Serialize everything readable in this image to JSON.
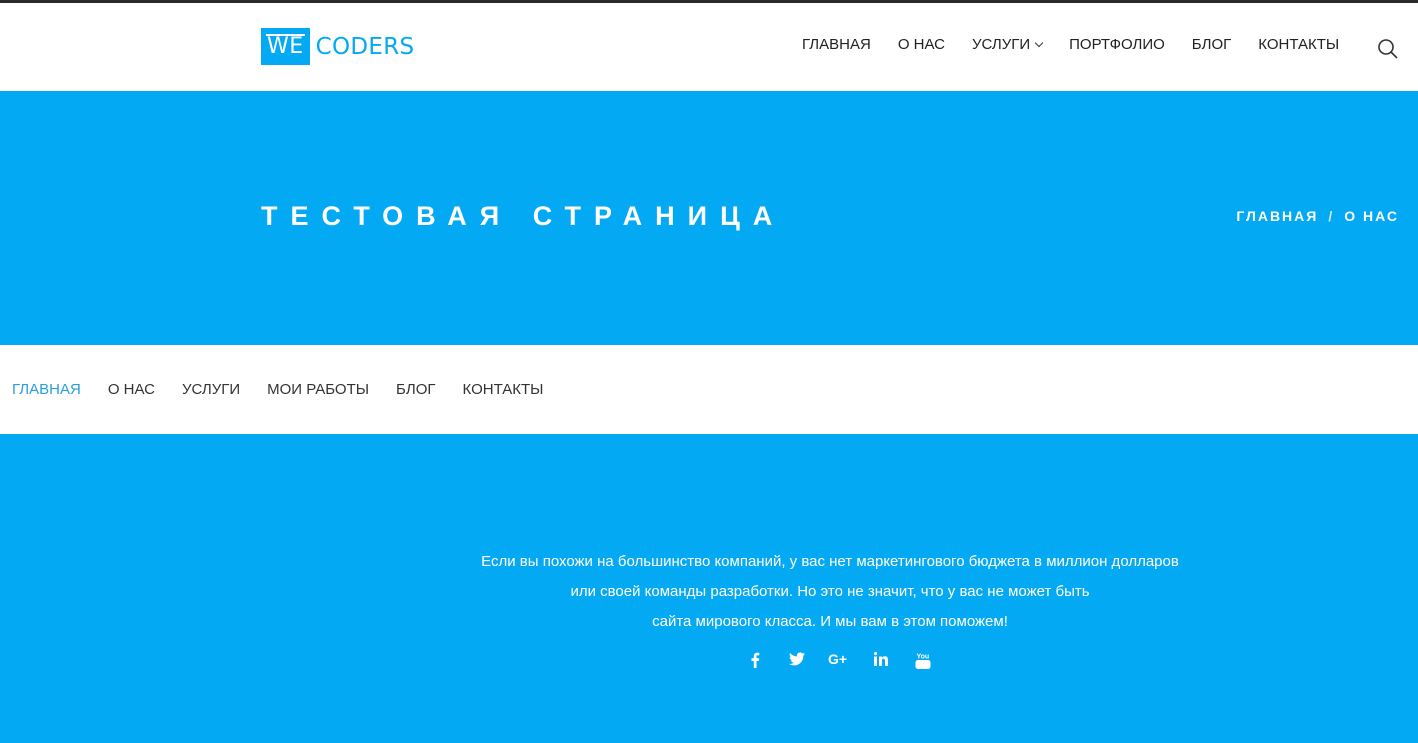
{
  "brand": {
    "logo_box": "WE",
    "logo_text": "CODERS",
    "accent": "#04a9f4"
  },
  "nav": {
    "items": [
      {
        "label": "ГЛАВНАЯ"
      },
      {
        "label": "О НАС"
      },
      {
        "label": "УСЛУГИ"
      },
      {
        "label": "ПОРТФОЛИО"
      },
      {
        "label": "БЛОГ"
      },
      {
        "label": "КОНТАКТЫ"
      }
    ],
    "search_icon": "search-icon"
  },
  "hero": {
    "title": "ТЕСТОВАЯ СТРАНИЦА",
    "breadcrumb": {
      "home": "ГЛАВНАЯ",
      "separator": "/",
      "current": "О НАС"
    }
  },
  "subnav": {
    "items": [
      {
        "label": "ГЛАВНАЯ"
      },
      {
        "label": "О НАС"
      },
      {
        "label": "УСЛУГИ"
      },
      {
        "label": "МОИ РАБОТЫ"
      },
      {
        "label": "БЛОГ"
      },
      {
        "label": "КОНТАКТЫ"
      }
    ]
  },
  "footer": {
    "lines": [
      "Если вы похожи на большинство компаний, у вас нет маркетингового бюджета в миллион долларов",
      "или своей команды разработки. Но это не значит, что у вас не может быть",
      "сайта мирового класса. И мы вам в этом поможем!"
    ],
    "social": [
      "facebook-icon",
      "twitter-icon",
      "google-plus-icon",
      "linkedin-icon",
      "youtube-icon"
    ]
  }
}
